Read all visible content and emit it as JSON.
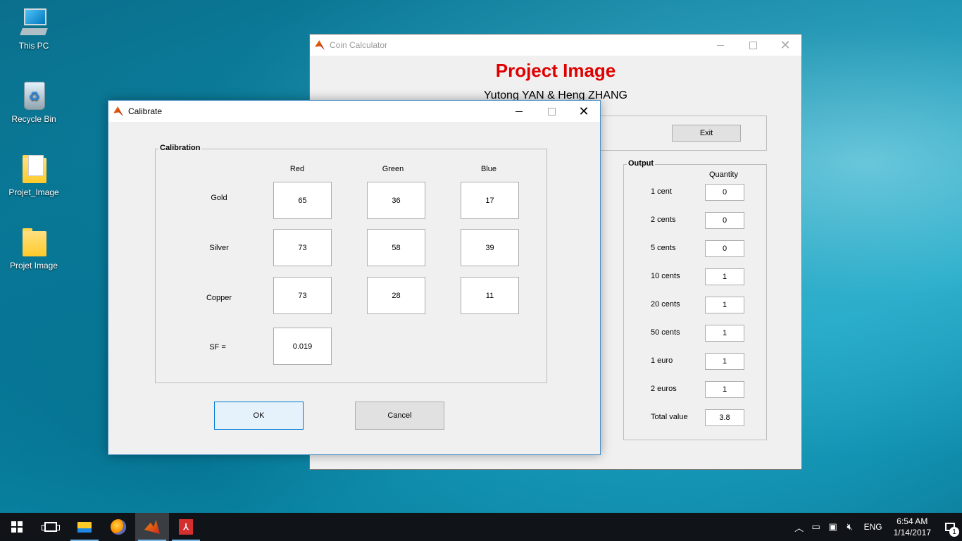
{
  "desktop": {
    "icons": [
      {
        "label": "This PC"
      },
      {
        "label": "Recycle Bin"
      },
      {
        "label": "Projet_Image"
      },
      {
        "label": "Projet Image"
      }
    ]
  },
  "coin_window": {
    "title": "Coin Calculator",
    "heading": "Project Image",
    "authors": "Yutong YAN & Heng ZHANG",
    "exit_label": "Exit",
    "output": {
      "panel_title": "Output",
      "column_header": "Quantity",
      "rows": [
        {
          "label": "1 cent",
          "value": "0"
        },
        {
          "label": "2 cents",
          "value": "0"
        },
        {
          "label": "5 cents",
          "value": "0"
        },
        {
          "label": "10 cents",
          "value": "1"
        },
        {
          "label": "20 cents",
          "value": "1"
        },
        {
          "label": "50 cents",
          "value": "1"
        },
        {
          "label": "1 euro",
          "value": "1"
        },
        {
          "label": "2 euros",
          "value": "1"
        },
        {
          "label": "Total value",
          "value": "3.8"
        }
      ]
    }
  },
  "calibrate_window": {
    "title": "Calibrate",
    "panel_title": "Calibration",
    "columns": [
      "Red",
      "Green",
      "Blue"
    ],
    "rows": [
      {
        "label": "Gold",
        "values": [
          "65",
          "36",
          "17"
        ]
      },
      {
        "label": "Silver",
        "values": [
          "73",
          "58",
          "39"
        ]
      },
      {
        "label": "Copper",
        "values": [
          "73",
          "28",
          "11"
        ]
      }
    ],
    "sf_label": "SF =",
    "sf_value": "0.019",
    "ok_label": "OK",
    "cancel_label": "Cancel"
  },
  "taskbar": {
    "language": "ENG",
    "time": "6:54 AM",
    "date": "1/14/2017",
    "notification_count": "1"
  },
  "colors": {
    "heading_red": "#e00000",
    "accent_blue": "#0078d7"
  }
}
